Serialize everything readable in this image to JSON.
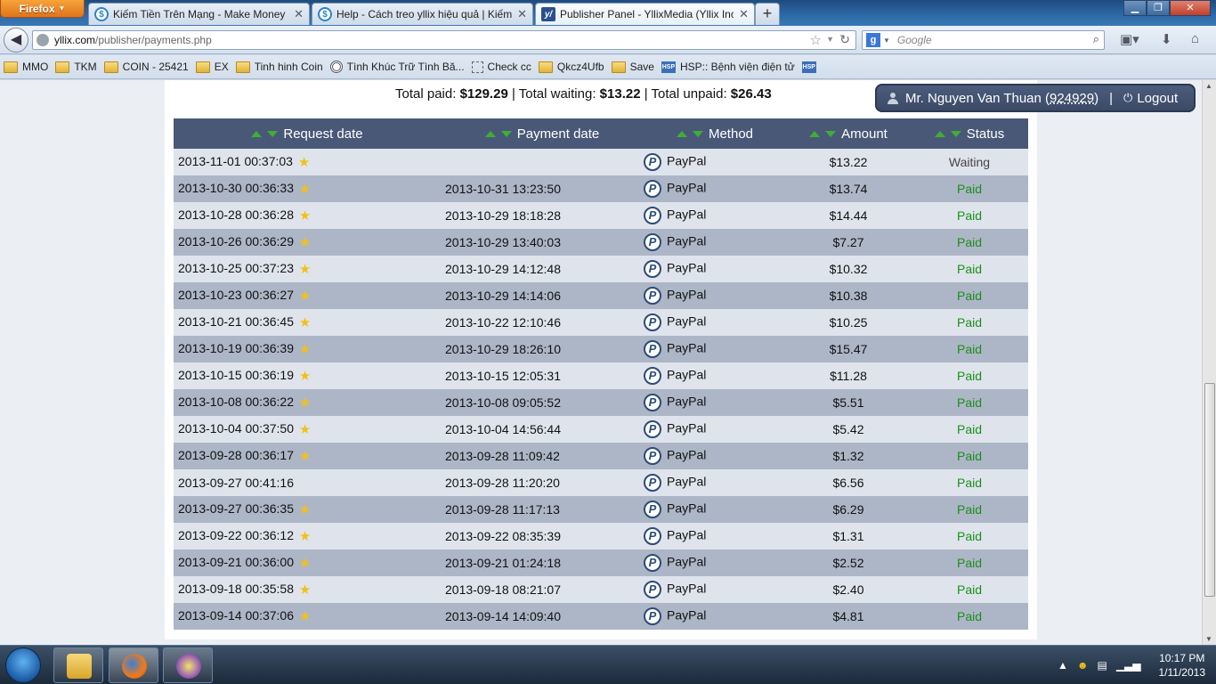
{
  "browser": {
    "menu_label": "Firefox",
    "tabs": [
      {
        "label": "Kiếm Tiền Trên Mạng - Make Money ...",
        "active": false
      },
      {
        "label": "Help - Cách treo yllix hiệu quả | Kiếm ...",
        "active": false
      },
      {
        "label": "Publisher Panel - YllixMedia (Yllix Inc.)",
        "active": true
      }
    ],
    "url_host": "yllix.com",
    "url_path": "/publisher/payments.php",
    "search_placeholder": "Google",
    "bookmarks": [
      {
        "label": "MMO",
        "icon": "folder-icon"
      },
      {
        "label": "TKM",
        "icon": "folder-icon"
      },
      {
        "label": "COIN - 25421",
        "icon": "folder-icon"
      },
      {
        "label": "EX",
        "icon": "folder-icon"
      },
      {
        "label": "Tinh hinh Coin",
        "icon": "folder-icon"
      },
      {
        "label": "Tình Khúc Trữ Tình Bă...",
        "icon": "circle-icon"
      },
      {
        "label": "Check cc",
        "icon": "dashed-page-icon"
      },
      {
        "label": "Qkcz4Ufb",
        "icon": "folder-icon"
      },
      {
        "label": "Save",
        "icon": "folder-icon"
      },
      {
        "label": "HSP:: Bệnh viện điện tử",
        "icon": "hsp-icon"
      }
    ]
  },
  "summary": {
    "paid_label": "Total paid:",
    "paid_value": "$129.29",
    "waiting_label": "Total waiting:",
    "waiting_value": "$13.22",
    "unpaid_label": "Total unpaid:",
    "unpaid_value": "$26.43",
    "sep": "|"
  },
  "user": {
    "name": "Mr. Nguyen Van Thuan",
    "id": "924929",
    "logout_label": "Logout"
  },
  "table": {
    "columns": [
      "Request date",
      "Payment date",
      "Method",
      "Amount",
      "Status"
    ],
    "rows": [
      {
        "request": "2013-11-01 00:37:03",
        "star": true,
        "payment": "",
        "method": "PayPal",
        "amount": "$13.22",
        "status": "Waiting"
      },
      {
        "request": "2013-10-30 00:36:33",
        "star": true,
        "payment": "2013-10-31 13:23:50",
        "method": "PayPal",
        "amount": "$13.74",
        "status": "Paid"
      },
      {
        "request": "2013-10-28 00:36:28",
        "star": true,
        "payment": "2013-10-29 18:18:28",
        "method": "PayPal",
        "amount": "$14.44",
        "status": "Paid"
      },
      {
        "request": "2013-10-26 00:36:29",
        "star": true,
        "payment": "2013-10-29 13:40:03",
        "method": "PayPal",
        "amount": "$7.27",
        "status": "Paid"
      },
      {
        "request": "2013-10-25 00:37:23",
        "star": true,
        "payment": "2013-10-29 14:12:48",
        "method": "PayPal",
        "amount": "$10.32",
        "status": "Paid"
      },
      {
        "request": "2013-10-23 00:36:27",
        "star": true,
        "payment": "2013-10-29 14:14:06",
        "method": "PayPal",
        "amount": "$10.38",
        "status": "Paid"
      },
      {
        "request": "2013-10-21 00:36:45",
        "star": true,
        "payment": "2013-10-22 12:10:46",
        "method": "PayPal",
        "amount": "$10.25",
        "status": "Paid"
      },
      {
        "request": "2013-10-19 00:36:39",
        "star": true,
        "payment": "2013-10-29 18:26:10",
        "method": "PayPal",
        "amount": "$15.47",
        "status": "Paid"
      },
      {
        "request": "2013-10-15 00:36:19",
        "star": true,
        "payment": "2013-10-15 12:05:31",
        "method": "PayPal",
        "amount": "$11.28",
        "status": "Paid"
      },
      {
        "request": "2013-10-08 00:36:22",
        "star": true,
        "payment": "2013-10-08 09:05:52",
        "method": "PayPal",
        "amount": "$5.51",
        "status": "Paid"
      },
      {
        "request": "2013-10-04 00:37:50",
        "star": true,
        "payment": "2013-10-04 14:56:44",
        "method": "PayPal",
        "amount": "$5.42",
        "status": "Paid"
      },
      {
        "request": "2013-09-28 00:36:17",
        "star": true,
        "payment": "2013-09-28 11:09:42",
        "method": "PayPal",
        "amount": "$1.32",
        "status": "Paid"
      },
      {
        "request": "2013-09-27 00:41:16",
        "star": false,
        "payment": "2013-09-28 11:20:20",
        "method": "PayPal",
        "amount": "$6.56",
        "status": "Paid"
      },
      {
        "request": "2013-09-27 00:36:35",
        "star": true,
        "payment": "2013-09-28 11:17:13",
        "method": "PayPal",
        "amount": "$6.29",
        "status": "Paid"
      },
      {
        "request": "2013-09-22 00:36:12",
        "star": true,
        "payment": "2013-09-22 08:35:39",
        "method": "PayPal",
        "amount": "$1.31",
        "status": "Paid"
      },
      {
        "request": "2013-09-21 00:36:00",
        "star": true,
        "payment": "2013-09-21 01:24:18",
        "method": "PayPal",
        "amount": "$2.52",
        "status": "Paid"
      },
      {
        "request": "2013-09-18 00:35:58",
        "star": true,
        "payment": "2013-09-18 08:21:07",
        "method": "PayPal",
        "amount": "$2.40",
        "status": "Paid"
      },
      {
        "request": "2013-09-14 00:37:06",
        "star": true,
        "payment": "2013-09-14 14:09:40",
        "method": "PayPal",
        "amount": "$4.81",
        "status": "Paid"
      }
    ]
  },
  "taskbar": {
    "time": "10:17 PM",
    "date": "1/11/2013"
  },
  "colors": {
    "header_bg": "#4a5878",
    "row_light": "#dfe4ec",
    "row_dark": "#adb6c6",
    "paid": "#1b8f1b",
    "sort_arrow": "#3fae34"
  }
}
